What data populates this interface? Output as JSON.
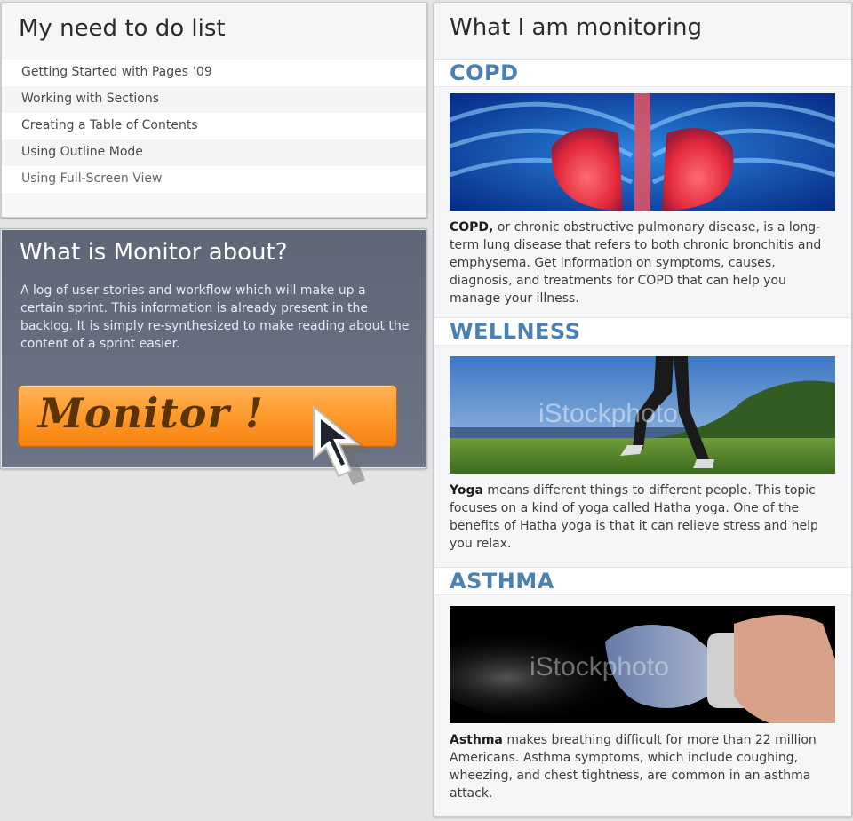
{
  "todo": {
    "title": "My need to do list",
    "items": [
      {
        "label": "Getting Started with Pages ’09"
      },
      {
        "label": "Working with Sections"
      },
      {
        "label": "Creating a Table of Contents"
      },
      {
        "label": "Using Outline Mode"
      },
      {
        "label": "Using Full-Screen View"
      }
    ]
  },
  "about": {
    "title": "What is Monitor about?",
    "body": "A log of user stories and workflow which will make up a certain sprint. This information is already present in the backlog. It is simply re-synthesized to make reading about the content of a sprint easier.",
    "button_label": "Monitor !"
  },
  "monitoring": {
    "title": "What I am monitoring",
    "sections": [
      {
        "heading": "COPD",
        "image": "lungs-image",
        "lead": "COPD,",
        "text": " or chronic obstructive pulmonary disease, is a long-term lung disease that refers to both chronic bronchitis and emphysema. Get information on symptoms, causes, diagnosis, and treatments for COPD that can help you manage your illness."
      },
      {
        "heading": "WELLNESS",
        "image": "runner-image",
        "image_watermark": "iStockphoto",
        "lead": "Yoga",
        "text": " means different things to different people. This topic focuses on a kind of yoga called Hatha yoga. One of the benefits of Hatha yoga is that it can relieve stress and help you relax."
      },
      {
        "heading": "ASTHMA",
        "image": "inhaler-image",
        "image_watermark": "iStockphoto",
        "lead": "Asthma",
        "text": " makes breathing difficult for more than 22 million Americans. Asthma symptoms, which include coughing, wheezing, and chest tightness, are common in an asthma attack."
      }
    ]
  },
  "colors": {
    "background": "#e3e4e6",
    "heading_blue": "#4a81b5",
    "button_orange": "#ff9d2f",
    "about_panel": "#646b7c"
  }
}
